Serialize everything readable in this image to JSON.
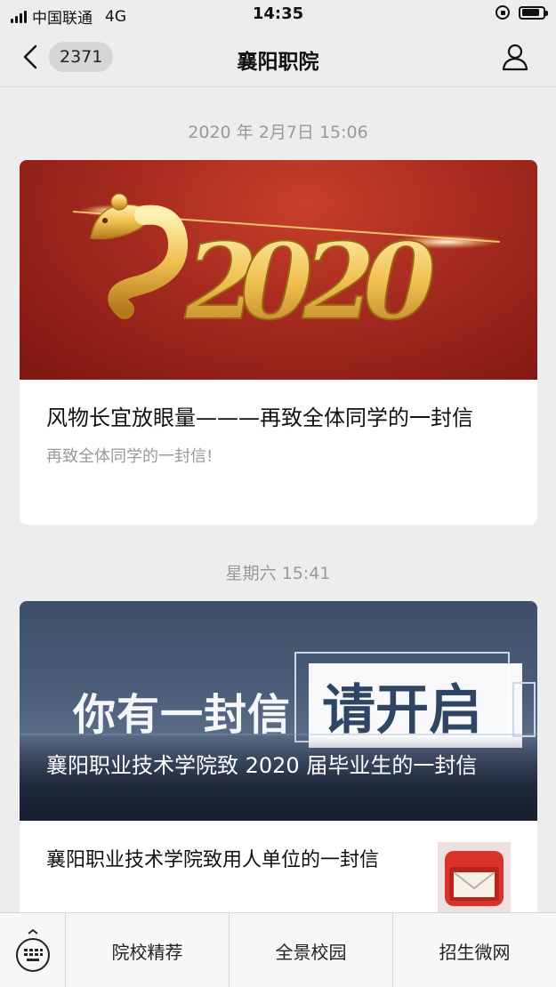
{
  "status_bar": {
    "carrier": "中国联通",
    "network": "4G",
    "time": "14:35",
    "battery_level": 0.85
  },
  "nav": {
    "unread_count": "2371",
    "title": "襄阳职院"
  },
  "feed": [
    {
      "timestamp": "2020 年 2月7日 15:06",
      "banner_text": "2020",
      "title": "风物长宜放眼量———再致全体同学的一封信",
      "description": "再致全体同学的一封信!"
    },
    {
      "timestamp": "星期六 15:41",
      "banner_text_left": "你有一封信",
      "banner_text_right": "请开启",
      "title": "襄阳职业技术学院致 2020 届毕业生的一封信",
      "sub_items": [
        {
          "title": "襄阳职业技术学院致用人单位的一封信",
          "thumb_icon": "envelope-icon"
        }
      ]
    }
  ],
  "bottom_menu": {
    "keyboard_icon": "keyboard-icon",
    "items": [
      "院校精荐",
      "全景校园",
      "招生微网"
    ]
  },
  "colors": {
    "background": "#ededed",
    "banner_red": "#a52a1f",
    "gold": "#f2c45a",
    "letter_blue": "#4a5c78"
  }
}
